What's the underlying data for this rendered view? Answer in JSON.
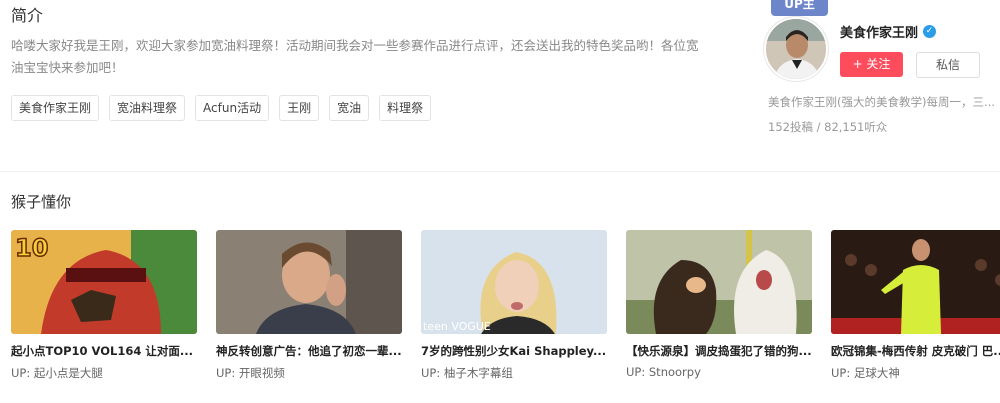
{
  "intro": {
    "title": "简介",
    "text": "哈喽大家好我是王刚，欢迎大家参加宽油料理祭！活动期间我会对一些参赛作品进行点评，还会送出我的特色奖品哟！各位宽油宝宝快来参加吧！",
    "tags": [
      "美食作家王刚",
      "宽油料理祭",
      "Acfun活动",
      "王刚",
      "宽油",
      "料理祭"
    ]
  },
  "uploader": {
    "badge": "UP主",
    "name": "美食作家王刚",
    "verified_icon": "✓",
    "follow_label": "+ 关注",
    "message_label": "私信",
    "description": "美食作家王刚(强大的美食教学)每周一，三...",
    "stats": "152投稿 / 82,151听众"
  },
  "recommend": {
    "title": "猴子懂你",
    "videos": [
      {
        "title": "起小点TOP10  VOL164  让对面...",
        "up": "UP:  起小点是大腿",
        "thumb_icon": "cartoon-thumbnail"
      },
      {
        "title": "神反转创意广告：他追了初恋一辈...",
        "up": "UP:  开眼视频",
        "thumb_icon": "boy-thumbnail"
      },
      {
        "title": "7岁的跨性别少女Kai  Shappley...",
        "up": "UP:  柚子木字幕组",
        "thumb_icon": "girl-thumbnail"
      },
      {
        "title": "【快乐源泉】调皮捣蛋犯了错的狗...",
        "up": "UP:  Stnoorpy",
        "thumb_icon": "dogs-thumbnail"
      },
      {
        "title": "欧冠锦集-梅西传射  皮克破门  巴...",
        "up": "UP:  足球大神",
        "thumb_icon": "soccer-thumbnail"
      }
    ]
  },
  "colors": {
    "follow": "#fd4c5c",
    "badge": "#6d86c9",
    "verified": "#2a9de8"
  }
}
